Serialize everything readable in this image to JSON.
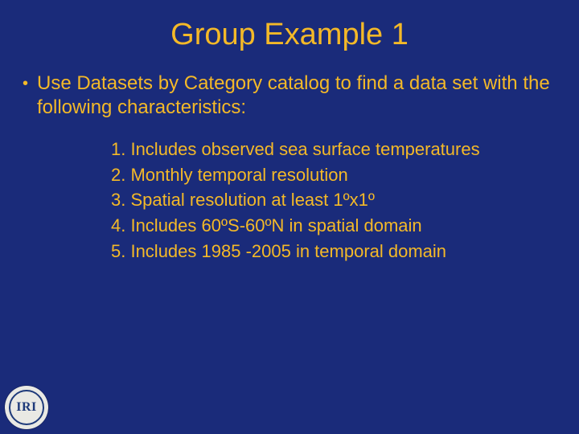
{
  "title": "Group Example 1",
  "bullet": "Use Datasets by Category catalog to find a data set with the following characteristics:",
  "items": [
    "1. Includes observed sea surface temperatures",
    "2. Monthly temporal resolution",
    "3. Spatial resolution at least 1ºx1º",
    "4. Includes 60ºS-60ºN in spatial domain",
    "5. Includes 1985 -2005 in temporal domain"
  ],
  "logo_text": "IRI"
}
